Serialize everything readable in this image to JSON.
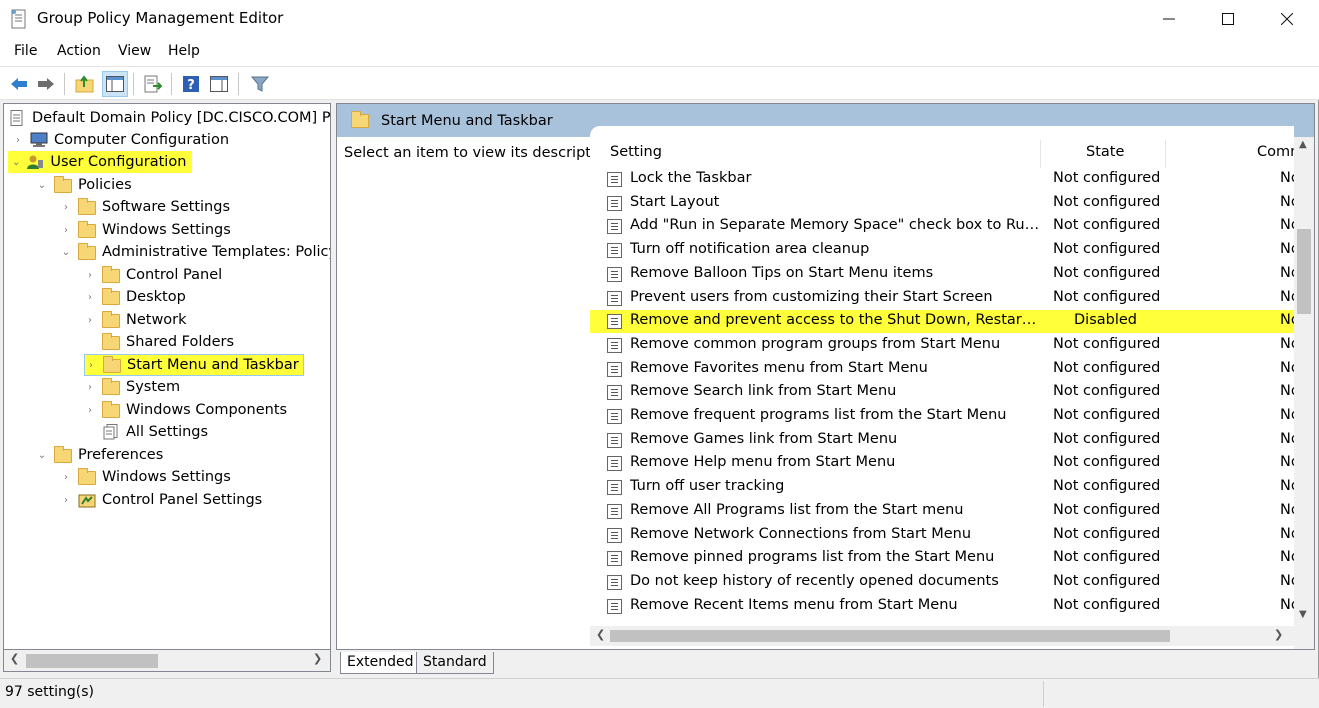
{
  "window": {
    "title": "Group Policy Management Editor"
  },
  "menu": [
    "File",
    "Action",
    "View",
    "Help"
  ],
  "tree": {
    "root": "Default Domain Policy [DC.CISCO.COM] Policy",
    "items": [
      {
        "label": "Computer Configuration"
      },
      {
        "label": "User Configuration"
      },
      {
        "label": "Policies"
      },
      {
        "label": "Software Settings"
      },
      {
        "label": "Windows Settings"
      },
      {
        "label": "Administrative Templates: Policy de"
      },
      {
        "label": "Control Panel"
      },
      {
        "label": "Desktop"
      },
      {
        "label": "Network"
      },
      {
        "label": "Shared Folders"
      },
      {
        "label": "Start Menu and Taskbar"
      },
      {
        "label": "System"
      },
      {
        "label": "Windows Components"
      },
      {
        "label": "All Settings"
      },
      {
        "label": "Preferences"
      },
      {
        "label": "Windows Settings"
      },
      {
        "label": "Control Panel Settings"
      }
    ]
  },
  "panel": {
    "header": "Start Menu and Taskbar",
    "description": "Select an item to view its description.",
    "columns": {
      "setting": "Setting",
      "state": "State",
      "comment": "Comm"
    }
  },
  "rows": [
    {
      "setting": "Lock the Taskbar",
      "state": "Not configured",
      "comment": "No"
    },
    {
      "setting": "Start Layout",
      "state": "Not configured",
      "comment": "No"
    },
    {
      "setting": "Add \"Run in Separate Memory Space\" check box to Run dialo...",
      "state": "Not configured",
      "comment": "No"
    },
    {
      "setting": "Turn off notification area cleanup",
      "state": "Not configured",
      "comment": "No"
    },
    {
      "setting": "Remove Balloon Tips on Start Menu items",
      "state": "Not configured",
      "comment": "No"
    },
    {
      "setting": "Prevent users from customizing their Start Screen",
      "state": "Not configured",
      "comment": "No"
    },
    {
      "setting": "Remove and prevent access to the Shut Down, Restart, Sleep, ...",
      "state": "Disabled",
      "comment": "No"
    },
    {
      "setting": "Remove common program groups from Start Menu",
      "state": "Not configured",
      "comment": "No"
    },
    {
      "setting": "Remove Favorites menu from Start Menu",
      "state": "Not configured",
      "comment": "No"
    },
    {
      "setting": "Remove Search link from Start Menu",
      "state": "Not configured",
      "comment": "No"
    },
    {
      "setting": "Remove frequent programs list from the Start Menu",
      "state": "Not configured",
      "comment": "No"
    },
    {
      "setting": "Remove Games link from Start Menu",
      "state": "Not configured",
      "comment": "No"
    },
    {
      "setting": "Remove Help menu from Start Menu",
      "state": "Not configured",
      "comment": "No"
    },
    {
      "setting": "Turn off user tracking",
      "state": "Not configured",
      "comment": "No"
    },
    {
      "setting": "Remove All Programs list from the Start menu",
      "state": "Not configured",
      "comment": "No"
    },
    {
      "setting": "Remove Network Connections from Start Menu",
      "state": "Not configured",
      "comment": "No"
    },
    {
      "setting": "Remove pinned programs list from the Start Menu",
      "state": "Not configured",
      "comment": "No"
    },
    {
      "setting": "Do not keep history of recently opened documents",
      "state": "Not configured",
      "comment": "No"
    },
    {
      "setting": "Remove Recent Items menu from Start Menu",
      "state": "Not configured",
      "comment": "No"
    }
  ],
  "tabs": [
    "Extended",
    "Standard"
  ],
  "status": "97 setting(s)",
  "colors": {
    "highlight": "#ffff3a",
    "header": "#a8c2dc",
    "folder": "#f7d675"
  }
}
